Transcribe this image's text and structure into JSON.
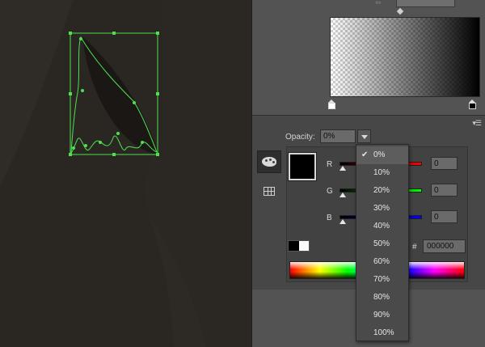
{
  "colors": {
    "canvas_bg": "#2a2622",
    "panel_bg": "#535353",
    "path_green": "#4fe04f",
    "red_field": "#cc2020",
    "green_field": "#20b020",
    "blue_field": "#2020cc"
  },
  "gradient_panel": {
    "left_stop_color": "#ffffff",
    "right_stop_color": "#000000"
  },
  "color_panel": {
    "opacity_label": "Opacity:",
    "opacity_value": "0%",
    "channels": [
      {
        "label": "R",
        "value": "0"
      },
      {
        "label": "G",
        "value": "0"
      },
      {
        "label": "B",
        "value": "0"
      }
    ],
    "hash": "#",
    "hex_value": "000000"
  },
  "opacity_dropdown": {
    "options": [
      "0%",
      "10%",
      "20%",
      "30%",
      "40%",
      "50%",
      "60%",
      "70%",
      "80%",
      "90%",
      "100%"
    ],
    "selected": "0%"
  },
  "icons": {
    "palette": "palette-icon",
    "swatches": "swatches-grid-icon",
    "menu": "panel-menu-icon",
    "check": "check-icon"
  }
}
